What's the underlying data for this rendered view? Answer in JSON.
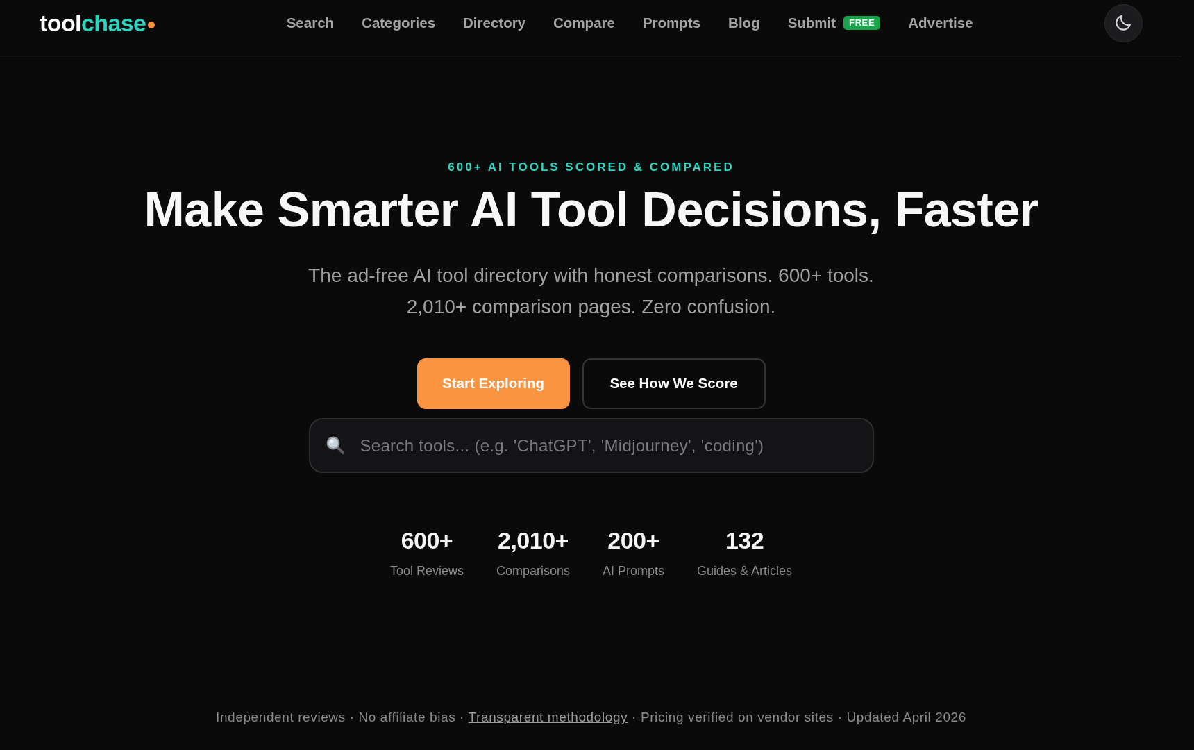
{
  "header": {
    "logo": {
      "text": "tool",
      "accent_text": "chase"
    },
    "nav": [
      {
        "label": "Search"
      },
      {
        "label": "Categories"
      },
      {
        "label": "Directory"
      },
      {
        "label": "Compare"
      },
      {
        "label": "Prompts"
      },
      {
        "label": "Blog"
      },
      {
        "label": "Submit",
        "badge": "FREE"
      },
      {
        "label": "Advertise"
      }
    ]
  },
  "hero": {
    "eyebrow": "600+ AI TOOLS SCORED & COMPARED",
    "title": "Make Smarter AI Tool Decisions, Faster",
    "subtitle_lines": [
      "The ad-free AI tool directory with honest comparisons. 600+ tools.",
      "2,010+ comparison pages. Zero confusion."
    ],
    "buttons": [
      {
        "label": "Start Exploring",
        "kind": "primary"
      },
      {
        "label": "See How We Score",
        "kind": "outline"
      }
    ],
    "search": {
      "placeholder": "Search tools... (e.g. 'ChatGPT', 'Midjourney', 'coding')"
    }
  },
  "stats": [
    {
      "value": "600+",
      "label": "Tool Reviews"
    },
    {
      "value": "2,010+",
      "label": "Comparisons"
    },
    {
      "value": "200+",
      "label": "AI Prompts"
    },
    {
      "value": "132",
      "label": "Guides & Articles"
    }
  ],
  "footer": {
    "parts": [
      {
        "kind": "text",
        "text": "Independent reviews · No affiliate bias ·"
      },
      {
        "kind": "link",
        "text": "Transparent methodology"
      },
      {
        "kind": "text",
        "text": "· Pricing verified on vendor sites · Updated April 2026"
      }
    ]
  }
}
